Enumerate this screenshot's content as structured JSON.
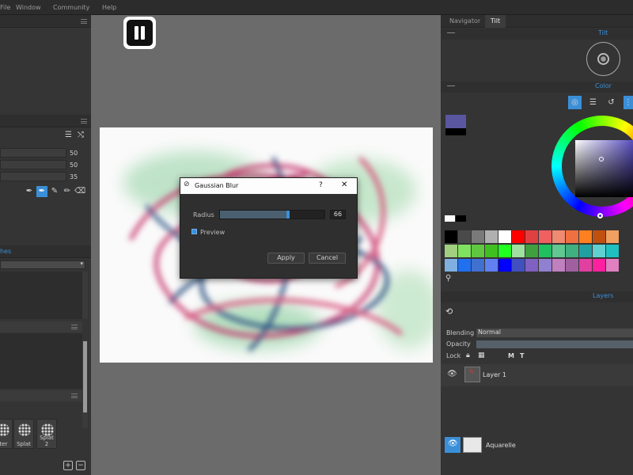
{
  "menu": {
    "items": [
      "File",
      "Window",
      "Community",
      "Help"
    ]
  },
  "left_panel": {
    "brush_sliders": [
      {
        "value": "50"
      },
      {
        "value": "50"
      },
      {
        "value": "35"
      }
    ],
    "brushes_tab_label": "hes",
    "brush_thumbs": [
      {
        "label": "tter"
      },
      {
        "label": "Splat"
      },
      {
        "label": "Splat 2"
      }
    ]
  },
  "right_panel": {
    "tabs": [
      {
        "label": "Navigator"
      },
      {
        "label": "Tilt"
      }
    ],
    "tilt_title": "Tilt",
    "color_title": "Color",
    "layers_title": "Layers",
    "current_color": "#5b56a0",
    "palette": [
      [
        "#000000",
        "#4a4a4a",
        "#7a7a7a",
        "#b0b0b0",
        "#ffffff",
        "#ff0000",
        "#e04040",
        "#f06060",
        "#f08a70",
        "#f07040",
        "#ff8020",
        "#c05010",
        "#f0a060"
      ],
      [
        "#a0d080",
        "#80e060",
        "#60c840",
        "#40c020",
        "#20ff20",
        "#a0e0a0",
        "#40a040",
        "#20c060",
        "#60c890",
        "#40b080",
        "#20a0a0",
        "#60d0d0",
        "#20c0c0"
      ],
      [
        "#80b0e0",
        "#2070f0",
        "#4070d0",
        "#6080f0",
        "#0000ff",
        "#4050c0",
        "#8060c0",
        "#9080d0",
        "#c080c0",
        "#a060a0",
        "#e040a0",
        "#ff20a0",
        "#e080c0"
      ]
    ],
    "blending_label": "Blending",
    "blending_value": "Normal",
    "opacity_label": "Opacity",
    "lock_label": "Lock",
    "lock_letters": [
      "M",
      "T"
    ],
    "layers": [
      {
        "name": "Layer 1"
      }
    ],
    "background_layer": {
      "name": "Aquarelle"
    }
  },
  "dialog": {
    "title": "Gaussian Blur",
    "help": "?",
    "close": "✕",
    "radius_label": "Radius",
    "radius_value": "66",
    "radius_fraction": 0.65,
    "preview_label": "Preview",
    "preview_checked": true,
    "apply_label": "Apply",
    "cancel_label": "Cancel"
  },
  "colors": {
    "accent": "#3a8fd8"
  }
}
